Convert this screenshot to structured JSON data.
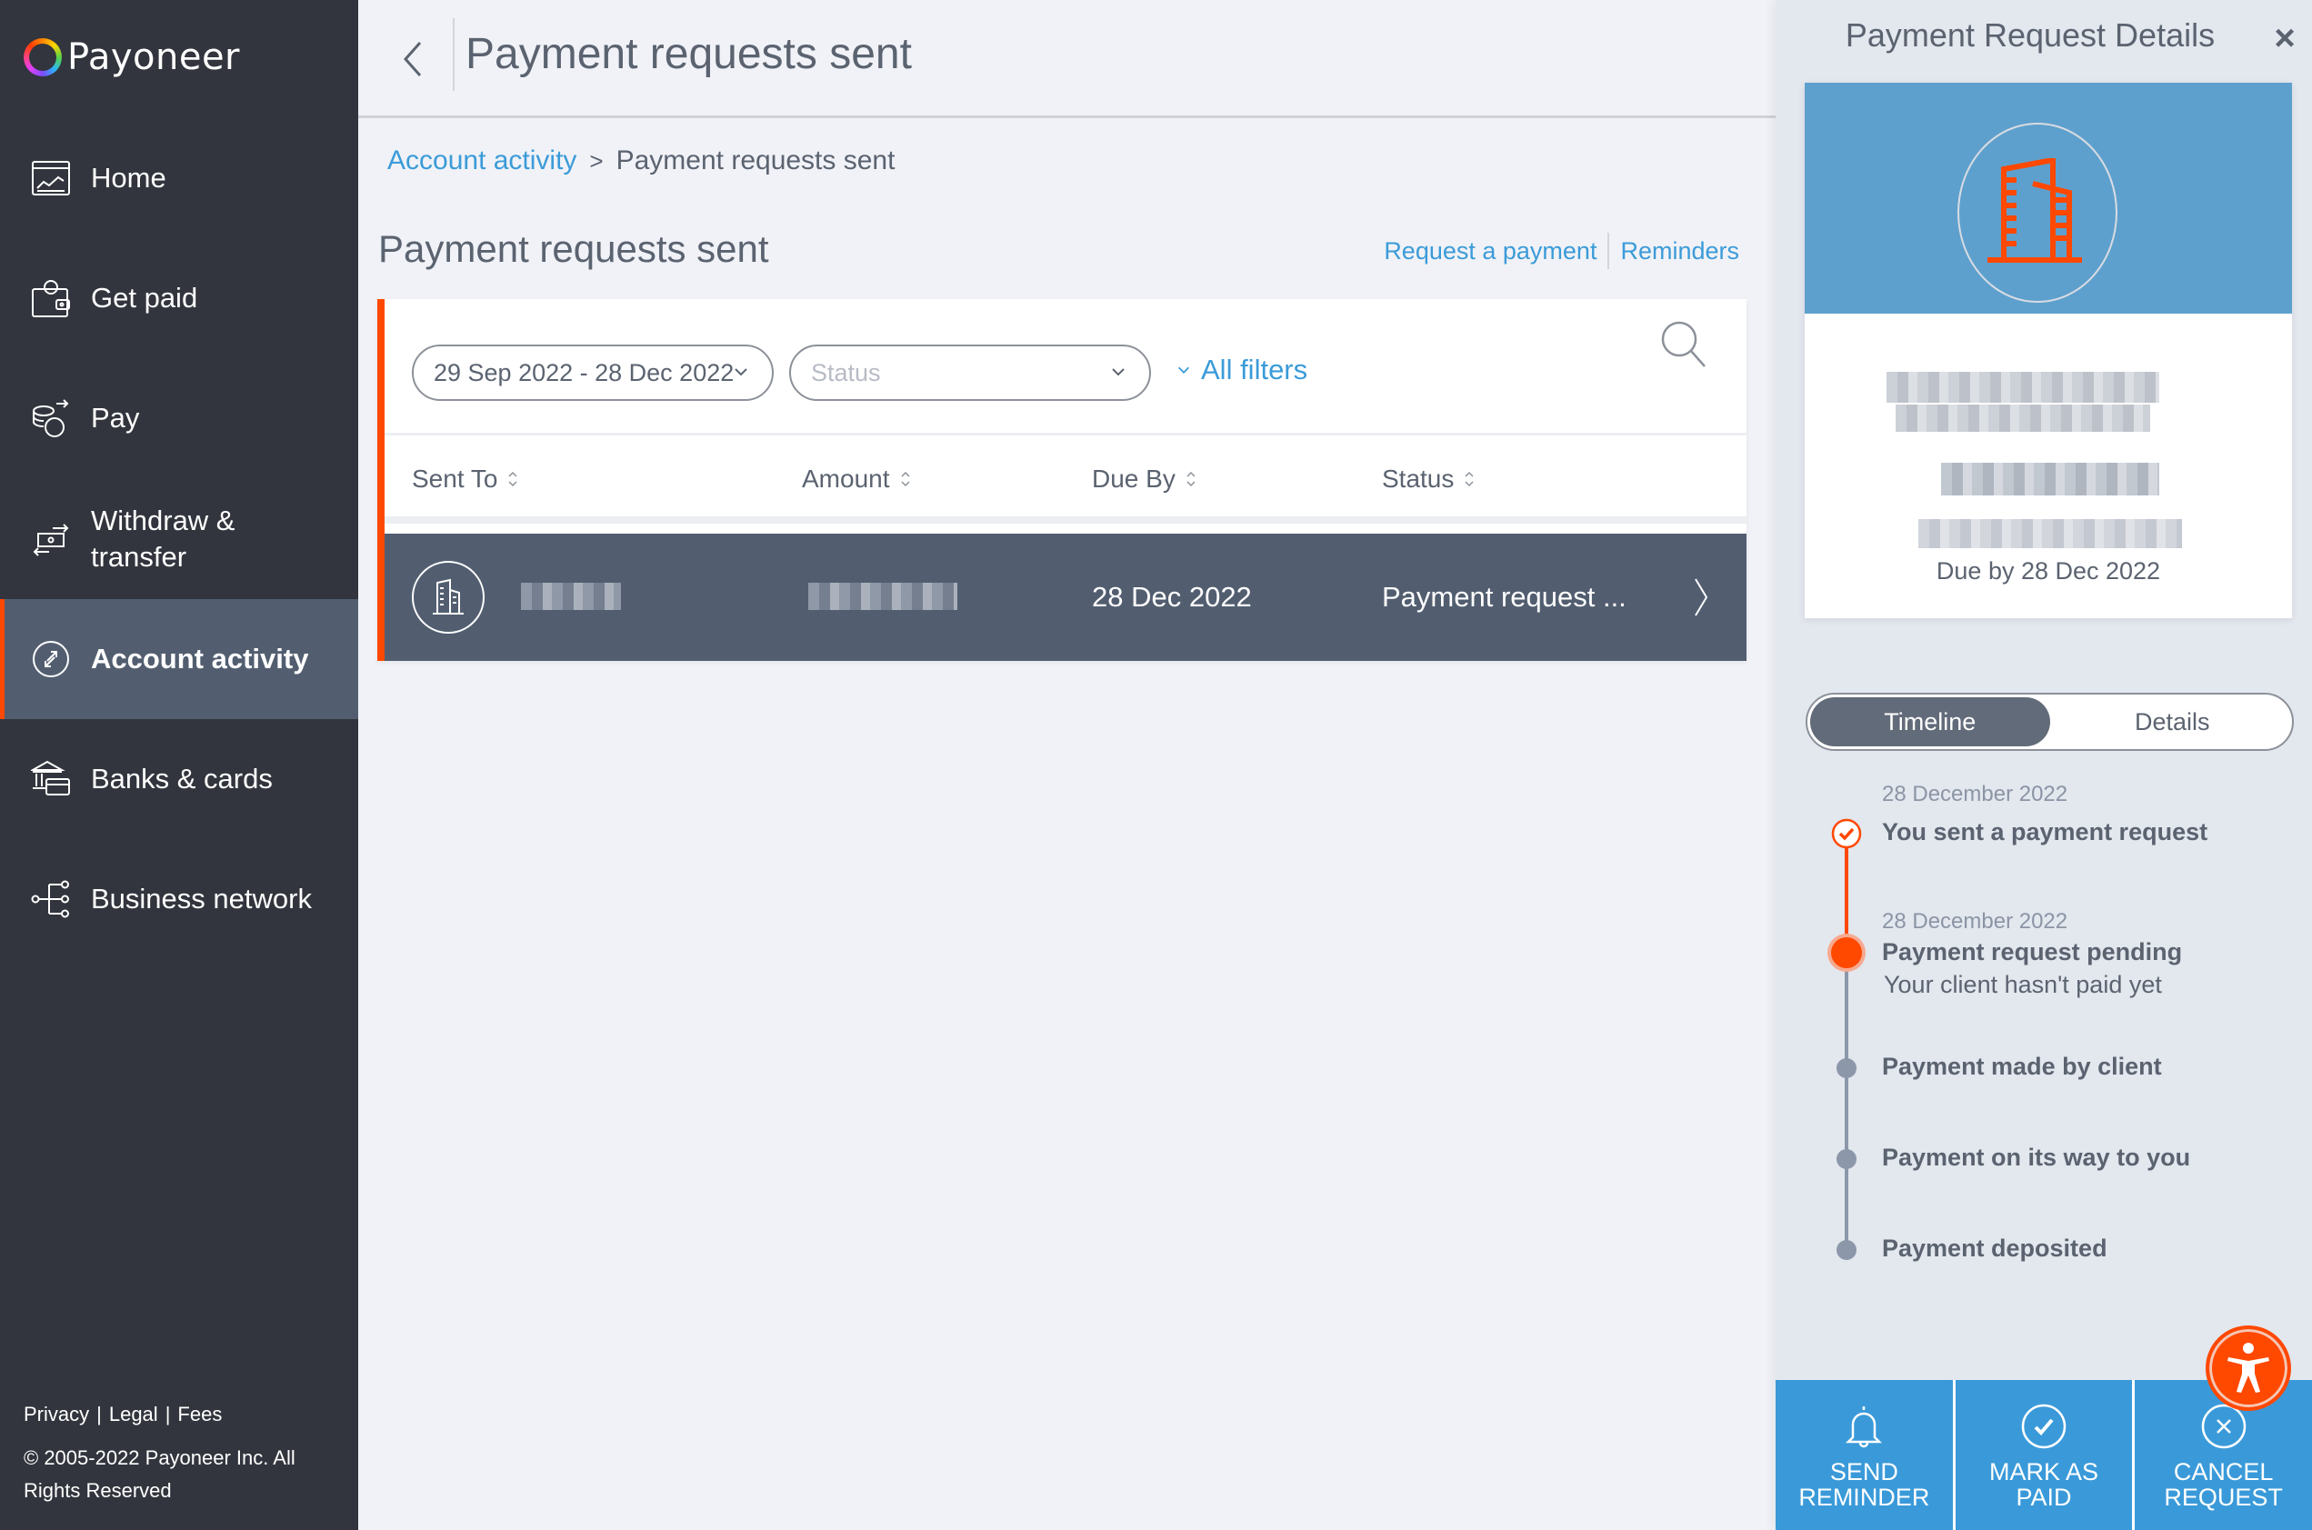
{
  "brand": {
    "name": "Payoneer"
  },
  "sidebar": {
    "items": [
      {
        "label": "Home",
        "icon": "home-chart-icon",
        "active": false
      },
      {
        "label": "Get paid",
        "icon": "wallet-icon",
        "active": false
      },
      {
        "label": "Pay",
        "icon": "coins-arrow-icon",
        "active": false
      },
      {
        "label": "Withdraw & transfer",
        "icon": "transfer-icon",
        "active": false
      },
      {
        "label": "Account activity",
        "icon": "activity-icon",
        "active": true
      },
      {
        "label": "Banks & cards",
        "icon": "bank-card-icon",
        "active": false
      },
      {
        "label": "Business network",
        "icon": "network-icon",
        "active": false
      }
    ],
    "footer": {
      "links": [
        "Privacy",
        "Legal",
        "Fees"
      ],
      "separator": "|",
      "copyright": "© 2005-2022 Payoneer Inc. All Rights Reserved"
    }
  },
  "main": {
    "title": "Payment requests sent",
    "breadcrumb": {
      "parent": "Account activity",
      "separator": ">",
      "current": "Payment requests sent"
    },
    "section_title": "Payment requests sent",
    "links": {
      "request_payment": "Request a payment",
      "reminders": "Reminders"
    },
    "filters": {
      "date_range": "29 Sep 2022 - 28 Dec 2022",
      "status_placeholder": "Status",
      "all_filters": "All filters"
    },
    "table": {
      "columns": [
        "Sent To",
        "Amount",
        "Due By",
        "Status"
      ],
      "rows": [
        {
          "sent_to": "[redacted]",
          "amount": "[redacted]",
          "due_by": "28 Dec 2022",
          "status": "Payment request ..."
        }
      ]
    }
  },
  "panel": {
    "title": "Payment Request Details",
    "close_label": "×",
    "summary": {
      "name": "[redacted]",
      "amount": "[redacted]",
      "email": "[redacted]",
      "due": "Due by 28 Dec 2022"
    },
    "tabs": [
      {
        "label": "Timeline",
        "active": true
      },
      {
        "label": "Details",
        "active": false
      }
    ],
    "timeline": [
      {
        "date": "28 December 2022",
        "title": "You sent a payment request",
        "subtitle": "",
        "state": "done"
      },
      {
        "date": "28 December 2022",
        "title": "Payment request pending",
        "subtitle": "Your client hasn't paid yet",
        "state": "current"
      },
      {
        "date": "",
        "title": "Payment made by client",
        "subtitle": "",
        "state": "future"
      },
      {
        "date": "",
        "title": "Payment on its way to you",
        "subtitle": "",
        "state": "future"
      },
      {
        "date": "",
        "title": "Payment deposited",
        "subtitle": "",
        "state": "future"
      }
    ],
    "actions": [
      {
        "label": "SEND REMINDER",
        "icon": "bell-icon"
      },
      {
        "label": "MARK AS PAID",
        "icon": "check-circle-icon"
      },
      {
        "label": "CANCEL REQUEST",
        "icon": "x-circle-icon"
      }
    ]
  },
  "colors": {
    "accent": "#ff4800",
    "link": "#3b9bd8",
    "sidebar_bg": "#32353d",
    "active_row": "#525e70",
    "action_blue": "#3a9ad9"
  }
}
